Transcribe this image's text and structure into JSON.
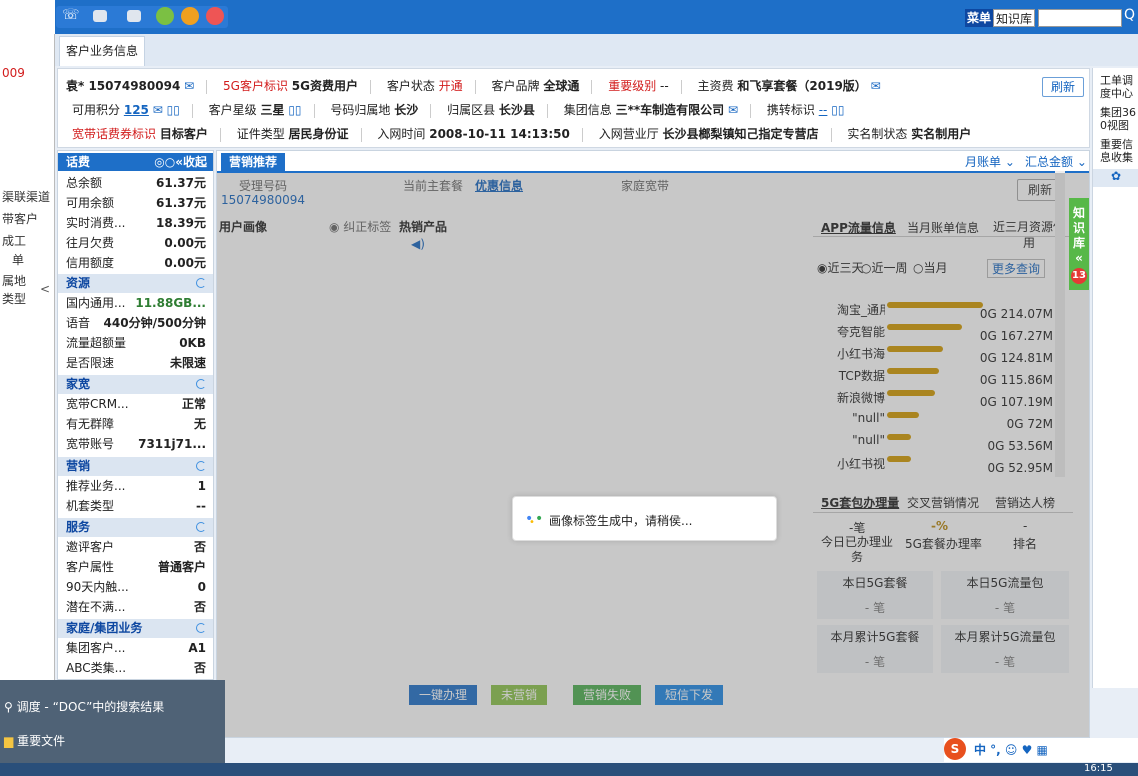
{
  "topbar": {
    "menu_label": "菜单",
    "kb_label": "知识库",
    "search_placeholder": ""
  },
  "left_strip": {
    "year_text": "009",
    "items": [
      "渠联渠道",
      "带客户",
      "成工",
      "单",
      "属地",
      "类型"
    ]
  },
  "tabs": [
    {
      "label": "客户业务信息"
    }
  ],
  "customer_info": {
    "row1": {
      "name": "袁* 15074980094",
      "fiveg_tag_label": "5G客户标识",
      "fiveg_tag_value": "5G资费用户",
      "status_label": "客户状态",
      "status_value": "开通",
      "brand_label": "客户品牌",
      "brand_value": "全球通",
      "importance_label": "重要级别",
      "importance_value": "--",
      "plan_label": "主资费",
      "plan_value": "和飞享套餐（2019版）",
      "refresh": "刷新"
    },
    "row2": {
      "points_label": "可用积分",
      "points_value": "125",
      "star_label": "客户星级",
      "star_value": "三星",
      "origin_label": "号码归属地",
      "origin_value": "长沙",
      "county_label": "归属区县",
      "county_value": "长沙县",
      "group_label": "集团信息",
      "group_value": "三**车制造有限公司",
      "transfer_label": "携转标识",
      "transfer_value": "--"
    },
    "row3": {
      "bb_label": "宽带话费券标识",
      "bb_value": "目标客户",
      "id_label": "证件类型",
      "id_value": "居民身份证",
      "join_label": "入网时间",
      "join_value": "2008-10-11 14:13:50",
      "hall_label": "入网营业厅",
      "hall_value": "长沙县榔梨镇知己指定专营店",
      "realname_label": "实名制状态",
      "realname_value": "实名制用户"
    }
  },
  "right_panel": {
    "items": [
      "工单调",
      "度中心",
      "集团36",
      "0视图",
      "重要信",
      "息收集"
    ]
  },
  "sidebar": {
    "header": "话费",
    "collapse": "«收起",
    "fee": [
      {
        "k": "总余额",
        "v": "61.37元"
      },
      {
        "k": "可用余额",
        "v": "61.37元"
      },
      {
        "k": "实时消费...",
        "v": "18.39元"
      },
      {
        "k": "往月欠费",
        "v": "0.00元"
      },
      {
        "k": "信用额度",
        "v": "0.00元"
      }
    ],
    "resource_title": "资源",
    "resource": [
      {
        "k": "国内通用...",
        "v": "11.88GB..."
      },
      {
        "k": "语音",
        "v": "440分钟/500分钟"
      },
      {
        "k": "流量超额量",
        "v": "0KB"
      },
      {
        "k": "是否限速",
        "v": "未限速"
      }
    ],
    "home_title": "家宽",
    "home": [
      {
        "k": "宽带CRM...",
        "v": "正常"
      },
      {
        "k": "有无群障",
        "v": "无"
      },
      {
        "k": "宽带账号",
        "v": "7311j71..."
      }
    ],
    "market_title": "营销",
    "market": [
      {
        "k": "推荐业务...",
        "v": "1"
      },
      {
        "k": "机套类型",
        "v": "--"
      }
    ],
    "service_title": "服务",
    "service": [
      {
        "k": "邀评客户",
        "v": "否"
      },
      {
        "k": "客户属性",
        "v": "普通客户"
      },
      {
        "k": "90天内触...",
        "v": "0"
      },
      {
        "k": "潜在不满...",
        "v": "否"
      }
    ],
    "family_title": "家庭/集团业务",
    "family": [
      {
        "k": "集团客户...",
        "v": "A1"
      },
      {
        "k": "ABC类集...",
        "v": "否"
      }
    ]
  },
  "main": {
    "tab": "营销推荐",
    "bill": "月账单",
    "summary": "汇总金额",
    "acc_label": "受理号码",
    "acc_value": "15074980094",
    "plan_label": "当前主套餐",
    "promo": "优惠信息",
    "home_bb": "家庭宽带",
    "refresh": "刷新",
    "portrait": "用户画像",
    "fix_tag": "纠正标签",
    "hot": "热销产品",
    "app_tabs": [
      "APP流量信息",
      "当月账单信息",
      "近三月资源使用"
    ],
    "radios": [
      "近三天",
      "近一周",
      "当月"
    ],
    "more": "更多查询",
    "fiveg_tabs": [
      "5G套包办理量",
      "交叉营销情况",
      "营销达人榜"
    ],
    "stat1_val": "-笔",
    "stat1_lbl": "今日已办理业务",
    "stat2_val": "-%",
    "stat2_lbl": "5G套餐办理率",
    "stat3_val": "-",
    "stat3_lbl": "排名",
    "box1_lbl": "本日5G套餐",
    "box1_val": "- 笔",
    "box2_lbl": "本日5G流量包",
    "box2_val": "- 笔",
    "box3_lbl": "本月累计5G套餐",
    "box3_val": "- 笔",
    "box4_lbl": "本月累计5G流量包",
    "box4_val": "- 笔",
    "actions": [
      "一键办理",
      "未营销",
      "营销失败",
      "短信下发"
    ],
    "kb_float": [
      "知",
      "识",
      "库",
      "«"
    ],
    "kb_badge": "13"
  },
  "dialog": {
    "text": "画像标签生成中，请稍侯..."
  },
  "chart_data": {
    "type": "bar",
    "categories": [
      "淘宝_通用",
      "夸克智能",
      "小红书海",
      "TCP数据",
      "新浪微博",
      "\"null\"",
      "\"null\"",
      "小红书视"
    ],
    "values": [
      214.07,
      167.27,
      124.81,
      115.86,
      107.19,
      72,
      53.56,
      52.95
    ],
    "value_labels": [
      "0G 214.07M",
      "0G 167.27M",
      "0G 124.81M",
      "0G 115.86M",
      "0G 107.19M",
      "0G 72M",
      "0G 53.56M",
      "0G 52.95M"
    ],
    "bar_color": "#d29a00"
  },
  "taskpopup": {
    "item1": "调度 - “DOC”中的搜索结果",
    "item2": "重要文件"
  },
  "ime": {
    "text": "中 °, ☺ ♥ ▦"
  },
  "clock": "16:15"
}
